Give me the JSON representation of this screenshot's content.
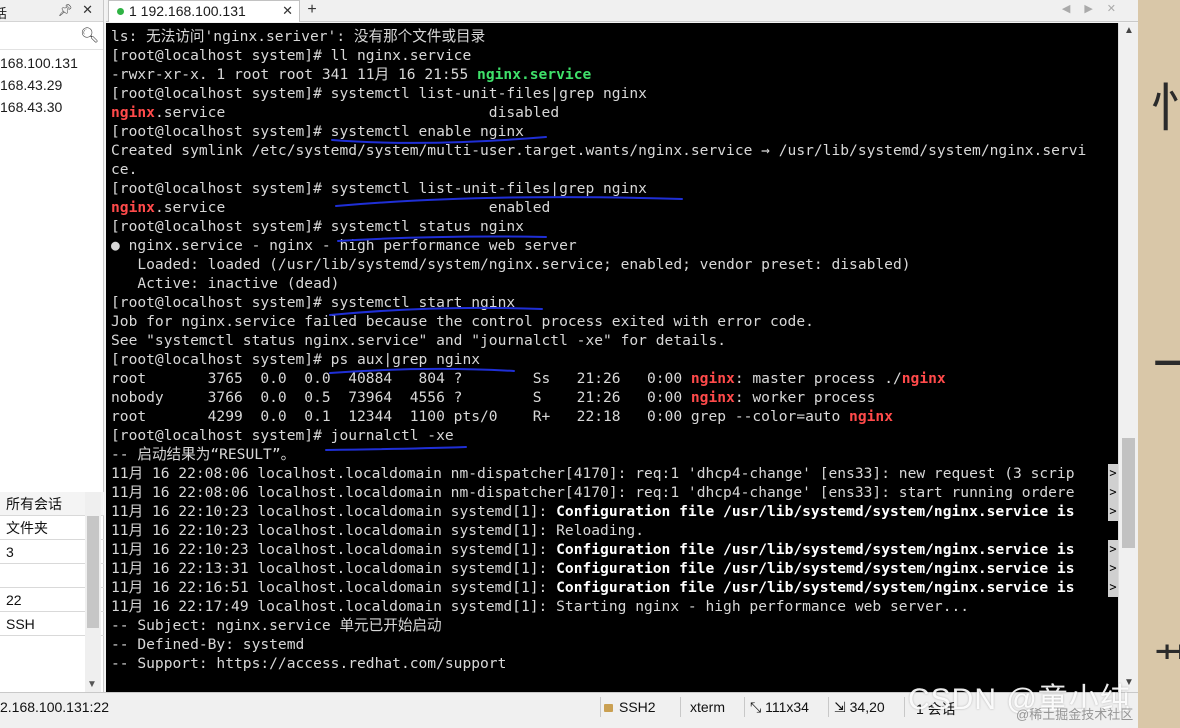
{
  "left_panel": {
    "header_title": "话",
    "hosts": [
      "168.100.131",
      "168.43.29",
      "168.43.30"
    ],
    "props": [
      "所有会话",
      "文件夹",
      "3",
      "",
      "22",
      "SSH"
    ]
  },
  "tab": {
    "label": "1 192.168.100.131"
  },
  "terminal": {
    "l1": "ls: 无法访问'nginx.seriver': 没有那个文件或目录",
    "l2": "[root@localhost system]# ll nginx.service",
    "l3a": "-rwxr-xr-x. 1 root root 341 11月 16 21:55 ",
    "l3b": "nginx.service",
    "l4": "[root@localhost system]# systemctl list-unit-files|grep nginx",
    "l5a": "nginx",
    "l5b": ".service                              disabled",
    "l6": "[root@localhost system]# systemctl enable nginx",
    "l7": "Created symlink /etc/systemd/system/multi-user.target.wants/nginx.service → /usr/lib/systemd/system/nginx.servi",
    "l8": "ce.",
    "l9": "[root@localhost system]# systemctl list-unit-files|grep nginx",
    "l10a": "nginx",
    "l10b": ".service                              enabled",
    "l11": "[root@localhost system]# systemctl status nginx",
    "l12": "● nginx.service - nginx - high performance web server",
    "l13": "   Loaded: loaded (/usr/lib/systemd/system/nginx.service; enabled; vendor preset: disabled)",
    "l14": "   Active: inactive (dead)",
    "l15": "[root@localhost system]# systemctl start nginx",
    "l16": "Job for nginx.service failed because the control process exited with error code.",
    "l17": "See \"systemctl status nginx.service\" and \"journalctl -xe\" for details.",
    "l18": "[root@localhost system]# ps aux|grep nginx",
    "l19a": "root       3765  0.0  0.0  40884   804 ?        Ss   21:26   0:00 ",
    "l19b": "nginx",
    "l19c": ": master process ./",
    "l19d": "nginx",
    "l20a": "nobody     3766  0.0  0.5  73964  4556 ?        S    21:26   0:00 ",
    "l20b": "nginx",
    "l20c": ": worker process",
    "l21a": "root       4299  0.0  0.1  12344  1100 pts/0    R+   22:18   0:00 grep --color=auto ",
    "l21b": "nginx",
    "l22": "[root@localhost system]# journalctl -xe",
    "l23": "-- 启动结果为“RESULT”。",
    "l24": "11月 16 22:08:06 localhost.localdomain nm-dispatcher[4170]: req:1 'dhcp4-change' [ens33]: new request (3 scrip",
    "l25": "11月 16 22:08:06 localhost.localdomain nm-dispatcher[4170]: req:1 'dhcp4-change' [ens33]: start running ordere",
    "l26a": "11月 16 22:10:23 localhost.localdomain systemd[1]: ",
    "l26b": "Configuration file /usr/lib/systemd/system/nginx.service is",
    "l27": "11月 16 22:10:23 localhost.localdomain systemd[1]: Reloading.",
    "l28a": "11月 16 22:10:23 localhost.localdomain systemd[1]: ",
    "l28b": "Configuration file /usr/lib/systemd/system/nginx.service is",
    "l29a": "11月 16 22:13:31 localhost.localdomain systemd[1]: ",
    "l29b": "Configuration file /usr/lib/systemd/system/nginx.service is",
    "l30a": "11月 16 22:16:51 localhost.localdomain systemd[1]: ",
    "l30b": "Configuration file /usr/lib/systemd/system/nginx.service is",
    "l31": "11月 16 22:17:49 localhost.localdomain systemd[1]: Starting nginx - high performance web server...",
    "l32": "-- Subject: nginx.service 单元已开始启动",
    "l33": "-- Defined-By: systemd",
    "l34": "-- Support: https://access.redhat.com/support",
    "overflow_arrow": ">"
  },
  "status_bar": {
    "host": "2.168.100.131:22",
    "protocol": "SSH2",
    "term": "xterm",
    "size": "111x34",
    "cursor": "34,20",
    "sessions": "1 会话"
  },
  "watermark": {
    "main": "CSDN @童小纯",
    "sub": "@稀土掘金技术社区"
  },
  "colors": {
    "prompt_green": "#3fe06a",
    "nginx_red": "#ff4a4a",
    "ink_blue": "#1f2fd6"
  }
}
